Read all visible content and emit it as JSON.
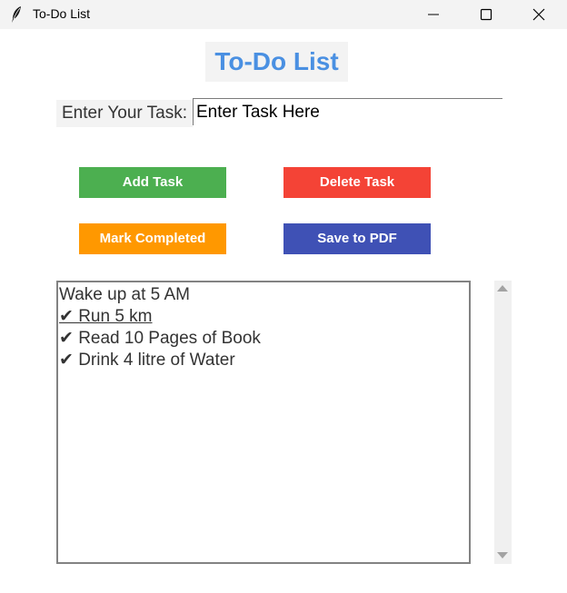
{
  "window": {
    "title": "To-Do List",
    "app_icon": "feather-icon",
    "controls": [
      "minimize-icon",
      "maximize-icon",
      "close-icon"
    ]
  },
  "header": {
    "title": "To-Do List",
    "color": "#4a90e2"
  },
  "task_entry": {
    "label": "Enter Your Task:",
    "value": "Enter Task Here"
  },
  "buttons": {
    "add": {
      "label": "Add Task",
      "color": "#4caf50"
    },
    "delete": {
      "label": "Delete Task",
      "color": "#f44336"
    },
    "mark": {
      "label": "Mark Completed",
      "color": "#ff9800"
    },
    "pdf": {
      "label": "Save to PDF",
      "color": "#3f51b5"
    }
  },
  "tasks": [
    {
      "text": "Wake up at 5 AM",
      "selected": false
    },
    {
      "text": "✔ Run 5 km",
      "selected": true
    },
    {
      "text": "✔ Read 10 Pages of Book",
      "selected": false
    },
    {
      "text": "✔ Drink 4 litre of Water",
      "selected": false
    }
  ]
}
